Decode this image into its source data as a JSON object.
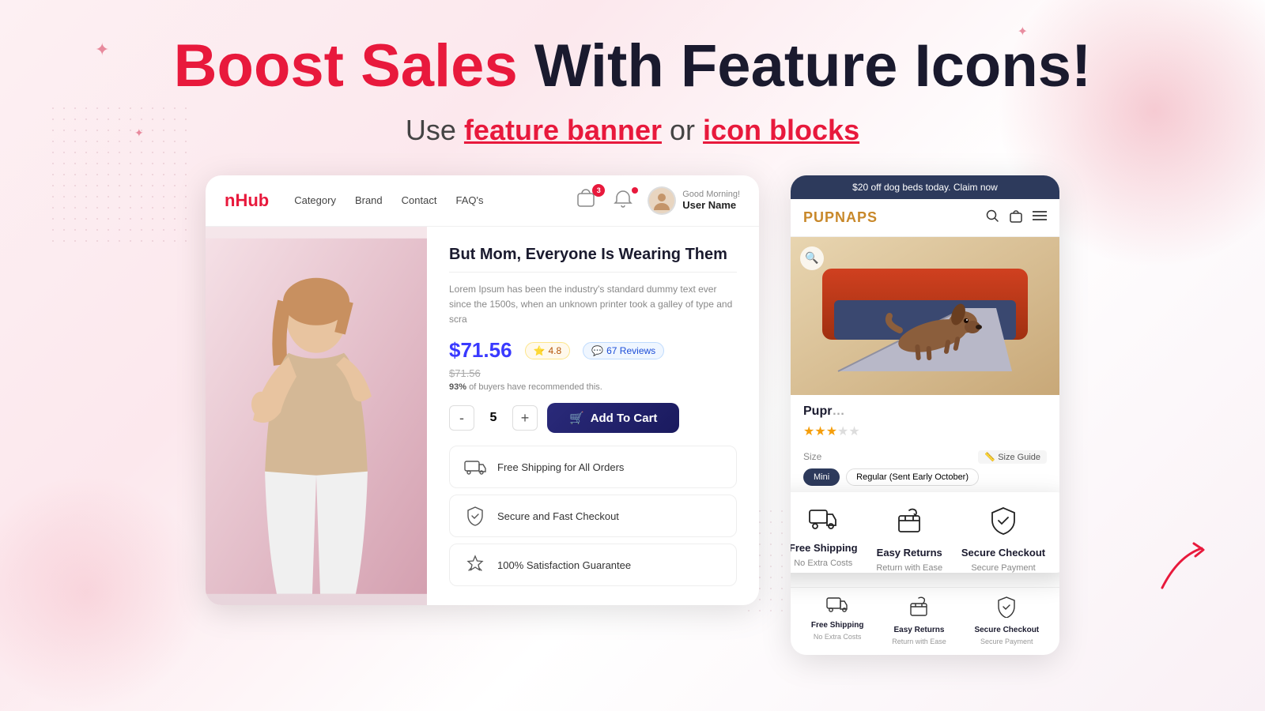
{
  "page": {
    "title": "Boost Sales With Feature Icons!",
    "title_red": "Boost Sales",
    "title_dark": "With Feature Icons!",
    "subtitle_pre": "Use",
    "link1_text": "feature banner",
    "subtitle_mid": " or ",
    "link2_text": "icon blocks",
    "bg_blob_colors": [
      "rgba(220,50,80,0.25)",
      "rgba(220,50,80,0.12)"
    ]
  },
  "mockup_left": {
    "logo": "nHub",
    "nav": [
      "Category",
      "Brand",
      "Contact",
      "FAQ's"
    ],
    "cart_badge": "3",
    "user_greeting": "Good Morning!",
    "user_name": "User Name",
    "product_title": "But Mom, Everyone Is Wearing Them",
    "product_desc": "Lorem Ipsum has been the industry's standard dummy text ever since the 1500s, when an unknown printer took a galley of type and scra",
    "price": "$71.56",
    "price_original": "$71.56",
    "rating": "4.8",
    "reviews": "67 Reviews",
    "recommend_pct": "93%",
    "recommend_text": "of buyers have recommended this.",
    "quantity": "5",
    "add_to_cart": "Add To Cart",
    "features": [
      {
        "icon": "🚚",
        "label": "Free Shipping for All Orders"
      },
      {
        "icon": "🛡️",
        "label": "Secure and Fast Checkout"
      },
      {
        "icon": "⭐",
        "label": "100% Satisfaction Guarantee"
      }
    ]
  },
  "mockup_right": {
    "banner_text": "$20 off dog beds today. Claim now",
    "logo": "PUPNAPS",
    "product_title": "Pupr",
    "stars_count": 3,
    "size_label": "Size",
    "size_guide": "Size Guide",
    "size_options": [
      "Mini",
      "Regular (Sent Early October)"
    ],
    "active_size": "Mini",
    "popup_features": [
      {
        "icon": "🚚",
        "title": "Free Shipping",
        "subtitle": "No Extra Costs"
      },
      {
        "icon": "📦",
        "title": "Easy Returns",
        "subtitle": "Return with Ease"
      },
      {
        "icon": "🛡️",
        "title": "Secure Checkout",
        "subtitle": "Secure Payment"
      }
    ],
    "bottom_features": [
      {
        "icon": "🚚",
        "title": "Free Shipping",
        "subtitle": "No Extra Costs"
      },
      {
        "icon": "📦",
        "title": "Easy Returns",
        "subtitle": "Return with Ease"
      },
      {
        "icon": "🛡️",
        "title": "Secure Checkout",
        "subtitle": "Secure Payment"
      }
    ]
  },
  "icons": {
    "cart": "🛒",
    "bell": "🔔",
    "search": "🔍",
    "bag": "🛍️",
    "menu": "☰",
    "star": "★",
    "arrow": "↗"
  }
}
